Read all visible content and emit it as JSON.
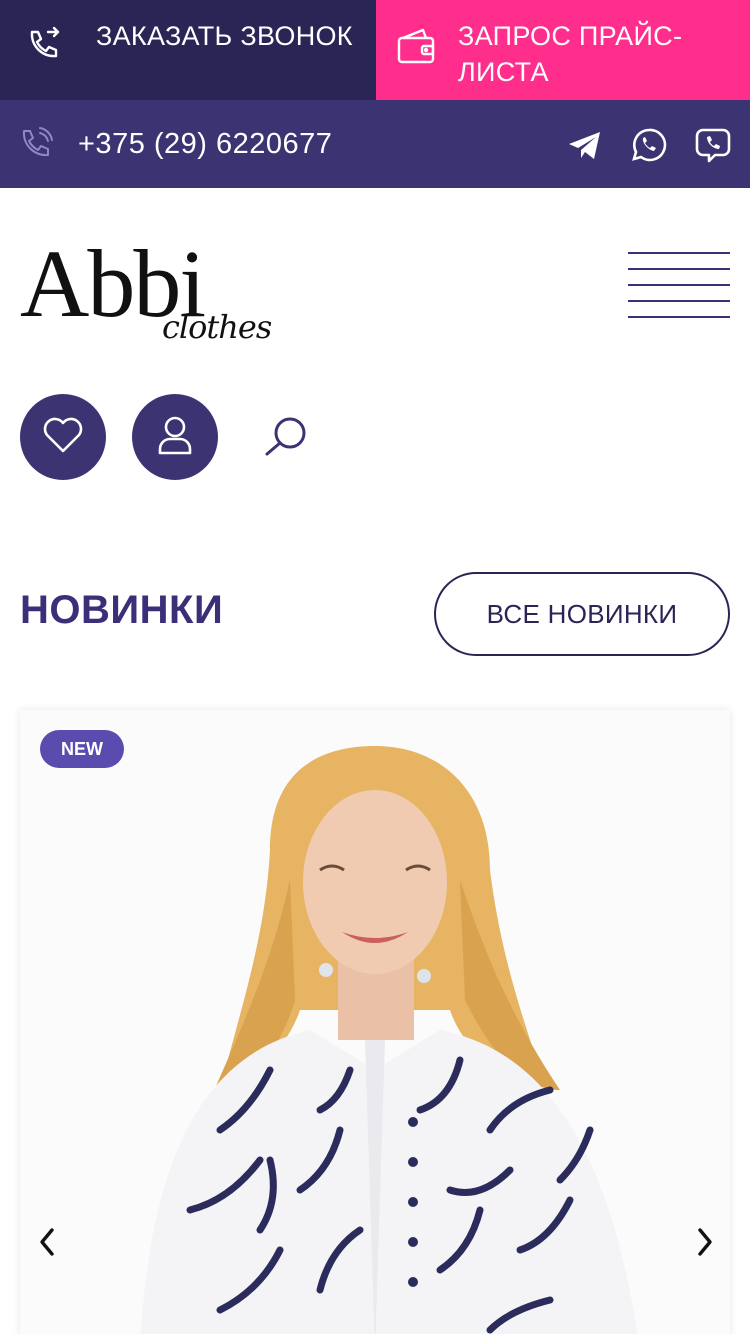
{
  "topbar": {
    "callback_label": "ЗАКАЗАТЬ ЗВОНОК",
    "price_label": "ЗАПРОС ПРАЙС-ЛИСТА",
    "callback_icon": "phone-callback-icon",
    "price_icon": "wallet-icon"
  },
  "contacts": {
    "phone": "+375 (29) 6220677",
    "phone_icon": "phone-icon",
    "socials": [
      "telegram-icon",
      "whatsapp-icon",
      "viber-icon"
    ]
  },
  "header": {
    "logo_main": "Abbi",
    "logo_sub": "clothes",
    "menu_icon": "hamburger-icon",
    "actions": [
      "heart-icon",
      "user-icon",
      "search-icon"
    ]
  },
  "section": {
    "title": "НОВИНКИ",
    "all_button": "ВСЕ НОВИНКИ"
  },
  "product": {
    "badge": "NEW",
    "prev_icon": "chevron-left-icon",
    "next_icon": "chevron-right-icon"
  },
  "colors": {
    "dark_navy": "#2b2556",
    "indigo": "#3c3373",
    "pink": "#ff2e8c",
    "badge": "#5a4cae",
    "text": "#3a2f78"
  }
}
